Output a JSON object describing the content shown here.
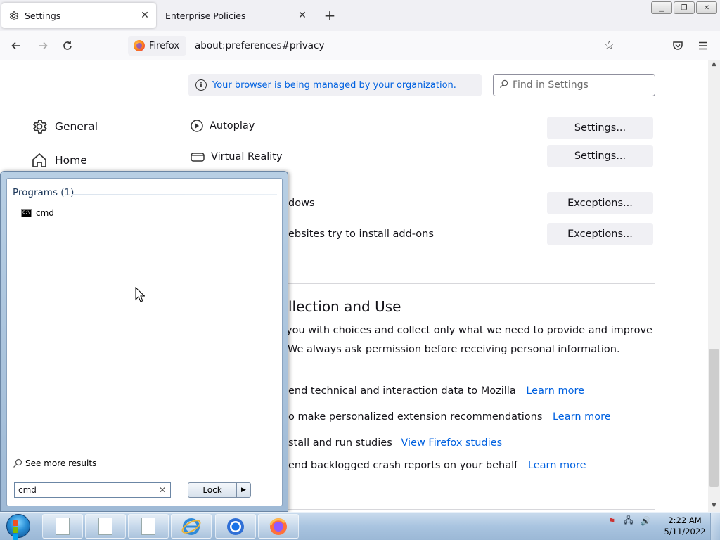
{
  "browser": {
    "tabs": [
      {
        "title": "Settings",
        "active": true,
        "icon": "gear-icon"
      },
      {
        "title": "Enterprise Policies",
        "active": false
      }
    ],
    "identity_label": "Firefox",
    "url": "about:preferences#privacy"
  },
  "settings_page": {
    "policy_banner": "Your browser is being managed by your organization.",
    "search_placeholder": "Find in Settings",
    "categories": [
      {
        "label": "General",
        "icon": "gear-icon"
      },
      {
        "label": "Home",
        "icon": "home-icon"
      }
    ],
    "permissions": [
      {
        "label": "Autoplay",
        "button": "Settings...",
        "icon": "autoplay-icon"
      },
      {
        "label": "Virtual Reality",
        "button": "Settings...",
        "icon": "vr-headset-icon"
      },
      {
        "label": "dows",
        "button": "Exceptions..."
      },
      {
        "label": "ebsites try to install add-ons",
        "button": "Exceptions..."
      }
    ],
    "data_collection": {
      "title": "llection and Use",
      "description_line1": "you with choices and collect only what we need to provide and improve",
      "description_line2": "We always ask permission before receiving personal information.",
      "options": [
        {
          "text": "end technical and interaction data to Mozilla",
          "link": "Learn more"
        },
        {
          "text": "o make personalized extension recommendations",
          "link": "Learn more"
        },
        {
          "text": "stall and run studies",
          "link": "View Firefox studies"
        },
        {
          "text": "end backlogged crash reports on your behalf",
          "link": "Learn more"
        }
      ]
    }
  },
  "start_menu": {
    "programs_header": "Programs (1)",
    "programs": [
      {
        "label": "cmd",
        "icon": "cmd-icon"
      }
    ],
    "see_more": "See more results",
    "search_value": "cmd",
    "lock_label": "Lock"
  },
  "taskbar": {
    "items": [
      "blank-document-icon",
      "blank-document-icon",
      "blank-document-icon",
      "internet-explorer-icon",
      "chrome-icon",
      "firefox-icon"
    ],
    "time": "2:22 AM",
    "date": "5/11/2022"
  },
  "colors": {
    "link": "#0061e0",
    "button_bg": "#f0f0f4",
    "taskbar": "#a9c4e0"
  }
}
